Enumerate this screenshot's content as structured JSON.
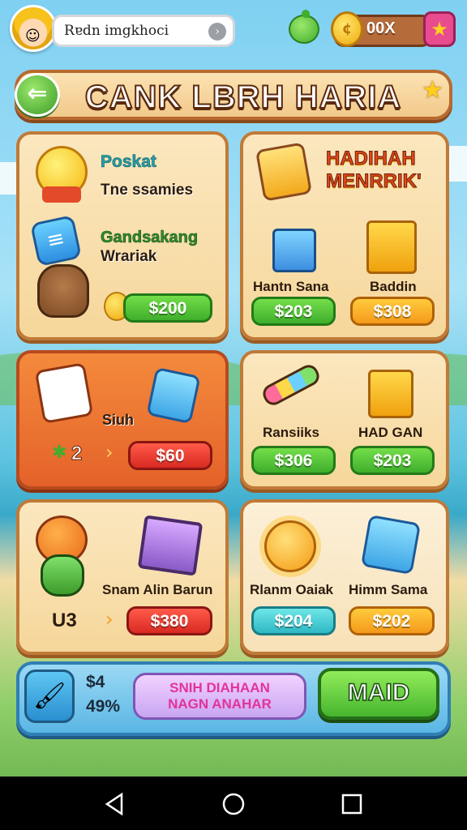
{
  "header": {
    "player_name": "Rɐdn imgkhoci",
    "coins": "00X"
  },
  "banner": {
    "title": "CANK LBRH HARIA"
  },
  "cards": {
    "c1": {
      "title1": "Poskat",
      "sub1": "Tne ssamies",
      "title2": "Gandsakang",
      "sub2": "Wrariak",
      "price": "$200"
    },
    "c2": {
      "title": "HADIHAH MENRRIK'",
      "item1": "Hantn Sana",
      "item2": "Baddin",
      "price1": "$203",
      "price2": "$308"
    },
    "c3": {
      "label": "Siuh",
      "count": "2",
      "price": "$60"
    },
    "c4": {
      "item1": "Ransiiks",
      "item2": "HAD GAN",
      "price1": "$306",
      "price2": "$203"
    },
    "c5": {
      "label": "Snam Alin Barun",
      "count": "U3",
      "price": "$380"
    },
    "c6": {
      "item1": "Rlanm Oaiak",
      "item2": "Himm Sama",
      "price1": "$204",
      "price2": "$202"
    }
  },
  "bottom": {
    "pct1": "$4",
    "pct2": "49%",
    "promo_line1": "SNIH DIAHAAN",
    "promo_line2": "NAGN ANAHAR",
    "action_label": "MAID"
  },
  "icons": {
    "back": "back-arrow-icon",
    "star": "star-icon",
    "coin": "coin-icon",
    "plus": "plus-icon",
    "brush": "paintbrush-icon"
  },
  "colors": {
    "wood_border": "#c07a38",
    "card_bg": "#f6d79b",
    "price_green": "#46b52e",
    "price_orange": "#f5991a",
    "price_red": "#d92a22",
    "price_teal": "#2fb8c4",
    "banner_text": "#ffffff"
  }
}
